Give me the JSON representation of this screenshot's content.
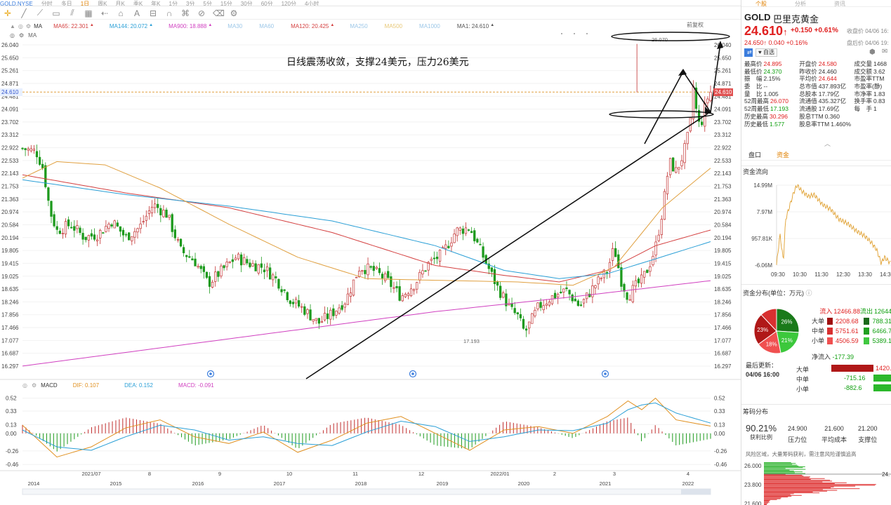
{
  "app": {
    "ticker": "GOLD.NYSE",
    "top_menu": [
      "分时",
      "多日",
      "1日",
      "周K",
      "月K",
      "季K",
      "年K",
      "1分",
      "3分",
      "5分",
      "15分",
      "30分",
      "60分",
      "120分",
      "4小时"
    ],
    "display_label": "显示"
  },
  "ma_bar": {
    "ma_label": "MA",
    "items": [
      {
        "text": "MA65: 22.301",
        "color": "#d44040"
      },
      {
        "text": "MA144: 20.072",
        "color": "#2a9fd6"
      },
      {
        "text": "MA900: 18.888",
        "color": "#d040c0"
      },
      {
        "text": "MA30",
        "color": "#9cc7e8"
      },
      {
        "text": "MA60",
        "color": "#9cc7e8"
      },
      {
        "text": "MA120: 20.425",
        "color": "#d44040"
      },
      {
        "text": "MA250",
        "color": "#9cc7e8"
      },
      {
        "text": "MA500",
        "color": "#e8c878"
      },
      {
        "text": "MA1000",
        "color": "#9cc7e8"
      },
      {
        "text": "MA1: 24.610",
        "color": "#555555"
      }
    ],
    "second_label": "MA",
    "prev_reset": "前复权",
    "current_price_tag": "24.610"
  },
  "annotation": "日线震荡收敛，支撑24美元，压力26美元",
  "macd_bar": {
    "label": "MACD",
    "dif": "DIF: 0.107",
    "dea": "DEA: 0.152",
    "macd": "MACD: -0.091",
    "colors": {
      "dif": "#e09020",
      "dea": "#2a9fd6",
      "macd": "#d040c0"
    }
  },
  "chart_data": [
    {
      "type": "candlestick",
      "title": "",
      "y_ticks": [
        "26.040",
        "25.650",
        "25.261",
        "24.871",
        "24.481",
        "24.091",
        "23.702",
        "23.312",
        "22.922",
        "22.533",
        "22.143",
        "21.753",
        "21.363",
        "20.974",
        "20.584",
        "20.194",
        "19.805",
        "19.415",
        "19.025",
        "18.635",
        "18.246",
        "17.856",
        "17.466",
        "17.077",
        "16.687",
        "16.297"
      ],
      "ylim": [
        16.297,
        26.04
      ],
      "marked_high": "26.070",
      "marked_low": "17.193",
      "current_price": 24.61,
      "x_ticks_upper": [
        "2021/07",
        "8",
        "9",
        "10",
        "11",
        "12",
        "2022/01",
        "2",
        "3",
        "4"
      ],
      "x_ticks_lower": [
        "2014",
        "2015",
        "2016",
        "2017",
        "2018",
        "2019",
        "2020",
        "2021",
        "2022"
      ],
      "moving_averages": [
        {
          "name": "MA65",
          "color": "#d44040",
          "points": [
            [
              0,
              22.1
            ],
            [
              0.15,
              21.55
            ],
            [
              0.3,
              21.1
            ],
            [
              0.45,
              20.35
            ],
            [
              0.6,
              19.35
            ],
            [
              0.7,
              19.05
            ],
            [
              0.78,
              18.85
            ],
            [
              0.85,
              19.2
            ],
            [
              0.92,
              19.95
            ],
            [
              1.0,
              20.425
            ]
          ]
        },
        {
          "name": "MA144",
          "color": "#2a9fd6",
          "points": [
            [
              0,
              21.95
            ],
            [
              0.15,
              21.5
            ],
            [
              0.3,
              21.15
            ],
            [
              0.45,
              20.7
            ],
            [
              0.6,
              19.95
            ],
            [
              0.7,
              19.2
            ],
            [
              0.78,
              18.95
            ],
            [
              0.85,
              19.1
            ],
            [
              0.92,
              19.55
            ],
            [
              1.0,
              20.072
            ]
          ]
        },
        {
          "name": "MA120",
          "color": "#e0a040",
          "points": [
            [
              0,
              22.0
            ],
            [
              0.05,
              22.5
            ],
            [
              0.12,
              22.4
            ],
            [
              0.2,
              21.7
            ],
            [
              0.3,
              20.6
            ],
            [
              0.4,
              19.6
            ],
            [
              0.5,
              18.95
            ],
            [
              0.6,
              18.9
            ],
            [
              0.72,
              18.85
            ],
            [
              0.8,
              18.75
            ],
            [
              0.86,
              19.3
            ],
            [
              0.93,
              21.1
            ],
            [
              1.0,
              22.301
            ]
          ]
        },
        {
          "name": "MA900",
          "color": "#d040c0",
          "points": [
            [
              0,
              16.3
            ],
            [
              0.2,
              16.85
            ],
            [
              0.4,
              17.4
            ],
            [
              0.6,
              17.95
            ],
            [
              0.8,
              18.4
            ],
            [
              1.0,
              18.888
            ]
          ]
        }
      ],
      "candles_path": [
        [
          0,
          22.9
        ],
        [
          0.02,
          22.8
        ],
        [
          0.03,
          22.3
        ],
        [
          0.04,
          21.0
        ],
        [
          0.05,
          20.4
        ],
        [
          0.07,
          20.6
        ],
        [
          0.09,
          20.2
        ],
        [
          0.11,
          20.3
        ],
        [
          0.13,
          20.7
        ],
        [
          0.15,
          20.2
        ],
        [
          0.17,
          20.5
        ],
        [
          0.19,
          21.2
        ],
        [
          0.21,
          20.9
        ],
        [
          0.23,
          19.8
        ],
        [
          0.25,
          19.5
        ],
        [
          0.27,
          18.8
        ],
        [
          0.29,
          19.2
        ],
        [
          0.31,
          19.6
        ],
        [
          0.33,
          19.4
        ],
        [
          0.35,
          19.3
        ],
        [
          0.37,
          18.9
        ],
        [
          0.39,
          18.3
        ],
        [
          0.41,
          18.0
        ],
        [
          0.43,
          17.6
        ],
        [
          0.45,
          17.9
        ],
        [
          0.47,
          18.3
        ],
        [
          0.49,
          19.3
        ],
        [
          0.51,
          19.2
        ],
        [
          0.53,
          18.9
        ],
        [
          0.55,
          18.4
        ],
        [
          0.57,
          18.8
        ],
        [
          0.59,
          19.4
        ],
        [
          0.61,
          19.7
        ],
        [
          0.63,
          20.4
        ],
        [
          0.65,
          20.5
        ],
        [
          0.67,
          19.6
        ],
        [
          0.69,
          18.7
        ],
        [
          0.71,
          18.0
        ],
        [
          0.72,
          17.8
        ],
        [
          0.73,
          17.3
        ],
        [
          0.75,
          18.1
        ],
        [
          0.77,
          18.4
        ],
        [
          0.79,
          18.6
        ],
        [
          0.81,
          18.1
        ],
        [
          0.83,
          18.7
        ],
        [
          0.85,
          19.2
        ],
        [
          0.86,
          19.9
        ],
        [
          0.87,
          18.9
        ],
        [
          0.88,
          18.4
        ],
        [
          0.89,
          18.7
        ],
        [
          0.9,
          18.9
        ],
        [
          0.91,
          19.3
        ],
        [
          0.92,
          19.9
        ],
        [
          0.93,
          21.0
        ],
        [
          0.94,
          22.5
        ],
        [
          0.95,
          22.2
        ],
        [
          0.96,
          22.7
        ],
        [
          0.97,
          23.5
        ],
        [
          0.975,
          24.8
        ],
        [
          0.98,
          23.9
        ],
        [
          0.985,
          23.5
        ],
        [
          0.99,
          24.0
        ],
        [
          0.995,
          24.4
        ],
        [
          1.0,
          24.61
        ]
      ],
      "macd": {
        "y_ticks": [
          "0.52",
          "0.33",
          "0.13",
          "0.00",
          "-0.26",
          "-0.46"
        ],
        "dif_points": [
          [
            0,
            0.12
          ],
          [
            0.05,
            -0.35
          ],
          [
            0.1,
            -0.2
          ],
          [
            0.15,
            0.08
          ],
          [
            0.2,
            0.2
          ],
          [
            0.25,
            -0.05
          ],
          [
            0.3,
            -0.15
          ],
          [
            0.35,
            0.02
          ],
          [
            0.4,
            -0.28
          ],
          [
            0.45,
            -0.1
          ],
          [
            0.5,
            0.15
          ],
          [
            0.55,
            0.25
          ],
          [
            0.6,
            0.0
          ],
          [
            0.65,
            -0.25
          ],
          [
            0.7,
            0.05
          ],
          [
            0.75,
            0.1
          ],
          [
            0.8,
            0.0
          ],
          [
            0.85,
            0.25
          ],
          [
            0.88,
            0.48
          ],
          [
            0.9,
            0.35
          ],
          [
            0.92,
            0.52
          ],
          [
            0.95,
            0.2
          ],
          [
            1.0,
            0.107
          ]
        ],
        "dea_points": [
          [
            0,
            0.05
          ],
          [
            0.05,
            -0.2
          ],
          [
            0.1,
            -0.25
          ],
          [
            0.15,
            -0.05
          ],
          [
            0.2,
            0.12
          ],
          [
            0.25,
            0.05
          ],
          [
            0.3,
            -0.1
          ],
          [
            0.35,
            -0.05
          ],
          [
            0.4,
            -0.15
          ],
          [
            0.45,
            -0.18
          ],
          [
            0.5,
            0.02
          ],
          [
            0.55,
            0.18
          ],
          [
            0.6,
            0.1
          ],
          [
            0.65,
            -0.12
          ],
          [
            0.7,
            -0.05
          ],
          [
            0.75,
            0.05
          ],
          [
            0.8,
            0.04
          ],
          [
            0.85,
            0.15
          ],
          [
            0.88,
            0.35
          ],
          [
            0.9,
            0.42
          ],
          [
            0.92,
            0.45
          ],
          [
            0.95,
            0.3
          ],
          [
            1.0,
            0.152
          ]
        ]
      }
    },
    {
      "type": "line",
      "title": "资金流向",
      "y_ticks": [
        "14.99M",
        "7.97M",
        "957.81K",
        "-6.06M"
      ],
      "x_ticks": [
        "09:30",
        "10:30",
        "11:30",
        "12:30",
        "13:30",
        "14:30"
      ],
      "ylim": [
        -6.06,
        14.99
      ],
      "points": [
        [
          0,
          -6.0
        ],
        [
          0.03,
          2.0
        ],
        [
          0.06,
          -5.0
        ],
        [
          0.08,
          6.0
        ],
        [
          0.1,
          8.0
        ],
        [
          0.15,
          13.0
        ],
        [
          0.18,
          14.99
        ],
        [
          0.22,
          13.5
        ],
        [
          0.28,
          12.0
        ],
        [
          0.33,
          12.5
        ],
        [
          0.4,
          10.0
        ],
        [
          0.48,
          8.5
        ],
        [
          0.55,
          6.0
        ],
        [
          0.62,
          5.0
        ],
        [
          0.7,
          3.0
        ],
        [
          0.78,
          1.5
        ],
        [
          0.83,
          0.0
        ],
        [
          0.88,
          -2.0
        ],
        [
          0.92,
          -5.5
        ],
        [
          0.95,
          -4.0
        ],
        [
          1.0,
          -5.5
        ]
      ],
      "color": "#e0a030"
    },
    {
      "type": "pie",
      "title": "资金分布(单位：万元)",
      "slices": [
        {
          "label": "26%",
          "value": 26,
          "color": "#1a7a1a"
        },
        {
          "label": "21%",
          "value": 21,
          "color": "#3cc83c"
        },
        {
          "label": "18%",
          "value": 18,
          "color": "#f05050"
        },
        {
          "label": "23%",
          "value": 23,
          "color": "#b01818"
        },
        {
          "label": "",
          "value": 12,
          "color": "#d83030"
        }
      ]
    },
    {
      "type": "bar",
      "title": "筹码分布",
      "y_ticks": [
        "26.000",
        "23.800",
        "21.600"
      ]
    }
  ],
  "right_panel": {
    "tabs": [
      "个股",
      "分析",
      "资讯"
    ],
    "symbol": "GOLD",
    "name": "巴里克黄金",
    "price": "24.610",
    "arrow": "↑",
    "change": "+0.150",
    "change_pct": "+0.61%",
    "close_time_label": "收盘价 04/06 16:",
    "after_price": "24.650↑",
    "after_change": "0.040",
    "after_pct": "+0.16%",
    "after_time_label": "盘后价 04/06 19:",
    "badge_self": "自选",
    "stats": [
      [
        {
          "l": "最高价",
          "v": "24.895",
          "c": "red"
        },
        {
          "l": "开盘价",
          "v": "24.580",
          "c": "red"
        },
        {
          "l": "成交量",
          "v": "1468",
          "c": ""
        }
      ],
      [
        {
          "l": "最低价",
          "v": "24.370",
          "c": "green"
        },
        {
          "l": "昨收价",
          "v": "24.460",
          "c": ""
        },
        {
          "l": "成交额",
          "v": "3.62",
          "c": ""
        }
      ],
      [
        {
          "l": "振　幅",
          "v": "2.15%",
          "c": ""
        },
        {
          "l": "平均价",
          "v": "24.644",
          "c": "red"
        },
        {
          "l": "市盈率TTM",
          "v": "",
          "c": ""
        }
      ],
      [
        {
          "l": "委　比",
          "v": "--",
          "c": ""
        },
        {
          "l": "总市值",
          "v": "437.893亿",
          "c": ""
        },
        {
          "l": "市盈率(静)",
          "v": "",
          "c": ""
        }
      ],
      [
        {
          "l": "量　比",
          "v": "1.005",
          "c": ""
        },
        {
          "l": "总股本",
          "v": "17.79亿",
          "c": ""
        },
        {
          "l": "市净率",
          "v": "1.83",
          "c": ""
        }
      ],
      [
        {
          "l": "52周最高",
          "v": "26.070",
          "c": "red"
        },
        {
          "l": "流通值",
          "v": "435.327亿",
          "c": ""
        },
        {
          "l": "换手率",
          "v": "0.83",
          "c": ""
        }
      ],
      [
        {
          "l": "52周最低",
          "v": "17.193",
          "c": "green"
        },
        {
          "l": "流通股",
          "v": "17.69亿",
          "c": ""
        },
        {
          "l": "每　手",
          "v": "1",
          "c": ""
        }
      ],
      [
        {
          "l": "历史最高",
          "v": "30.296",
          "c": "red"
        },
        {
          "l": "股息TTM",
          "v": "0.360",
          "c": ""
        },
        {
          "l": "",
          "v": "",
          "c": ""
        }
      ],
      [
        {
          "l": "历史最低",
          "v": "1.577",
          "c": "green"
        },
        {
          "l": "股息率TTM",
          "v": "1.460%",
          "c": ""
        },
        {
          "l": "",
          "v": "",
          "c": ""
        }
      ]
    ],
    "sub_tabs": [
      "盘口",
      "资金"
    ],
    "fund_flow_title": "资金流向",
    "fund_dist_title": "资金分布(单位：万元)",
    "flow_in_label": "流入",
    "flow_in_value": "12466.88",
    "flow_out_label": "流出",
    "flow_out_value": "12644",
    "flow_rows": [
      {
        "label": "大单",
        "in": "2208.68",
        "out": "788.31"
      },
      {
        "label": "中单",
        "in": "5751.61",
        "out": "6466.7"
      },
      {
        "label": "小单",
        "in": "4506.59",
        "out": "5389.1"
      }
    ],
    "net_label": "净流入",
    "net_value": "-177.39",
    "update_label": "最后更新：",
    "update_time": "04/06 16:00",
    "net_rows": [
      {
        "label": "大单",
        "value": "1420.37",
        "positive": true
      },
      {
        "label": "中单",
        "value": "-715.16",
        "positive": false
      },
      {
        "label": "小单",
        "value": "-882.6",
        "positive": false
      }
    ],
    "chip_title": "筹码分布",
    "chip_profit_pct": "90.21%",
    "chip_profit_label": "获利比例",
    "chip_pressure": "24.900",
    "chip_pressure_label": "压力位",
    "chip_avg": "21.600",
    "chip_avg_label": "平均成本",
    "chip_support": "21.200",
    "chip_support_label": "支撑位",
    "chip_note": "风险区域，大量筹码获利，需注意风险谨慎追高",
    "chip_price_tag": "24."
  }
}
